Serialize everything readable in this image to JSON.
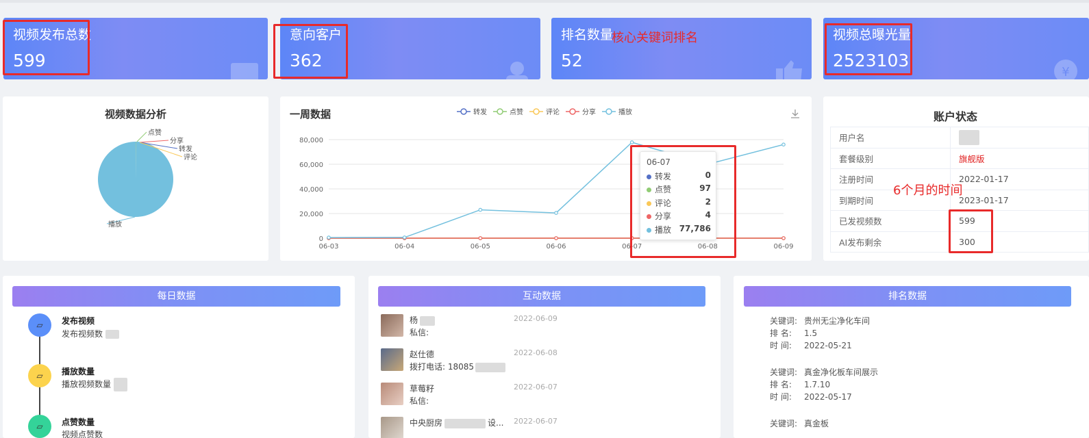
{
  "stat_cards": [
    {
      "label": "视频发布总数",
      "value": "599"
    },
    {
      "label": "意向客户",
      "value": "362"
    },
    {
      "label": "排名数量",
      "value": "52",
      "note": "核心关键词排名"
    },
    {
      "label": "视频总曝光量",
      "value": "2523103"
    }
  ],
  "pie_panel": {
    "title": "视频数据分析",
    "labels": [
      "点赞",
      "分享",
      "转发",
      "评论",
      "播放"
    ]
  },
  "line_panel": {
    "title": "一周数据",
    "legend": [
      "转发",
      "点赞",
      "评论",
      "分享",
      "播放"
    ],
    "tooltip": {
      "date": "06-07",
      "rows": [
        {
          "name": "转发",
          "value": "0",
          "color": "#5470c6"
        },
        {
          "name": "点赞",
          "value": "97",
          "color": "#91cc75"
        },
        {
          "name": "评论",
          "value": "2",
          "color": "#fac858"
        },
        {
          "name": "分享",
          "value": "4",
          "color": "#ee6666"
        },
        {
          "name": "播放",
          "value": "77,786",
          "color": "#73c0de"
        }
      ]
    }
  },
  "chart_data": [
    {
      "type": "pie",
      "title": "视频数据分析",
      "labels": [
        "点赞",
        "分享",
        "转发",
        "评论",
        "播放"
      ],
      "values": [
        97,
        4,
        0,
        2,
        77786
      ]
    },
    {
      "type": "line",
      "title": "一周数据",
      "x": [
        "06-03",
        "06-04",
        "06-05",
        "06-06",
        "06-07",
        "06-08",
        "06-09"
      ],
      "y_ticks": [
        "0",
        "20,000",
        "40,000",
        "60,000",
        "80,000"
      ],
      "ylim": [
        0,
        80000
      ],
      "series": [
        {
          "name": "转发",
          "color": "#5470c6",
          "values": [
            0,
            0,
            0,
            0,
            0,
            0,
            0
          ]
        },
        {
          "name": "点赞",
          "color": "#91cc75",
          "values": [
            0,
            0,
            0,
            0,
            97,
            0,
            0
          ]
        },
        {
          "name": "评论",
          "color": "#fac858",
          "values": [
            0,
            0,
            0,
            0,
            2,
            0,
            0
          ]
        },
        {
          "name": "分享",
          "color": "#ee6666",
          "values": [
            0,
            0,
            0,
            0,
            4,
            0,
            0
          ]
        },
        {
          "name": "播放",
          "color": "#73c0de",
          "values": [
            500,
            600,
            23000,
            20500,
            77786,
            60000,
            76000
          ]
        }
      ],
      "legend": "top-center",
      "grid": true
    }
  ],
  "account_panel": {
    "title": "账户状态",
    "rows": [
      {
        "key": "用户名",
        "value": ""
      },
      {
        "key": "套餐级别",
        "value": "旗舰版"
      },
      {
        "key": "注册时间",
        "value": "2022-01-17"
      },
      {
        "key": "到期时间",
        "value": "2023-01-17"
      },
      {
        "key": "已发视频数",
        "value": "599"
      },
      {
        "key": "AI发布剩余",
        "value": "300"
      }
    ],
    "note": "6个月的时间"
  },
  "daily_panel": {
    "title": "每日数据",
    "items": [
      {
        "title": "发布视频",
        "sub": "发布视频数",
        "color": "#5b8ff9",
        "icon": "▱"
      },
      {
        "title": "播放数量",
        "sub": "播放视频数量",
        "color": "#fcd34d",
        "icon": "▱"
      },
      {
        "title": "点赞数量",
        "sub": "视频点赞数",
        "color": "#34d399",
        "icon": "▱"
      }
    ]
  },
  "interaction_panel": {
    "title": "互动数据",
    "items": [
      {
        "name": "杨",
        "text": "私信:",
        "date": "2022-06-09"
      },
      {
        "name": "赵仕德",
        "text": "拨打电话: 18085",
        "date": "2022-06-08"
      },
      {
        "name": "草莓籽",
        "text": "私信:",
        "date": "2022-06-07"
      },
      {
        "name": "中央厨房",
        "text": "",
        "date": "2022-06-07",
        "suffix": "设..."
      }
    ]
  },
  "ranking_panel": {
    "title": "排名数据",
    "labels": {
      "keyword": "关键词:",
      "rank": "排 名:",
      "time": "时 间:"
    },
    "items": [
      {
        "keyword": "贵州无尘净化车间",
        "rank": "1.5",
        "time": "2022-05-21"
      },
      {
        "keyword": "真金净化板车间展示",
        "rank": "1.7.10",
        "time": "2022-05-17"
      },
      {
        "keyword": "真金板",
        "rank": "",
        "time": ""
      }
    ]
  }
}
